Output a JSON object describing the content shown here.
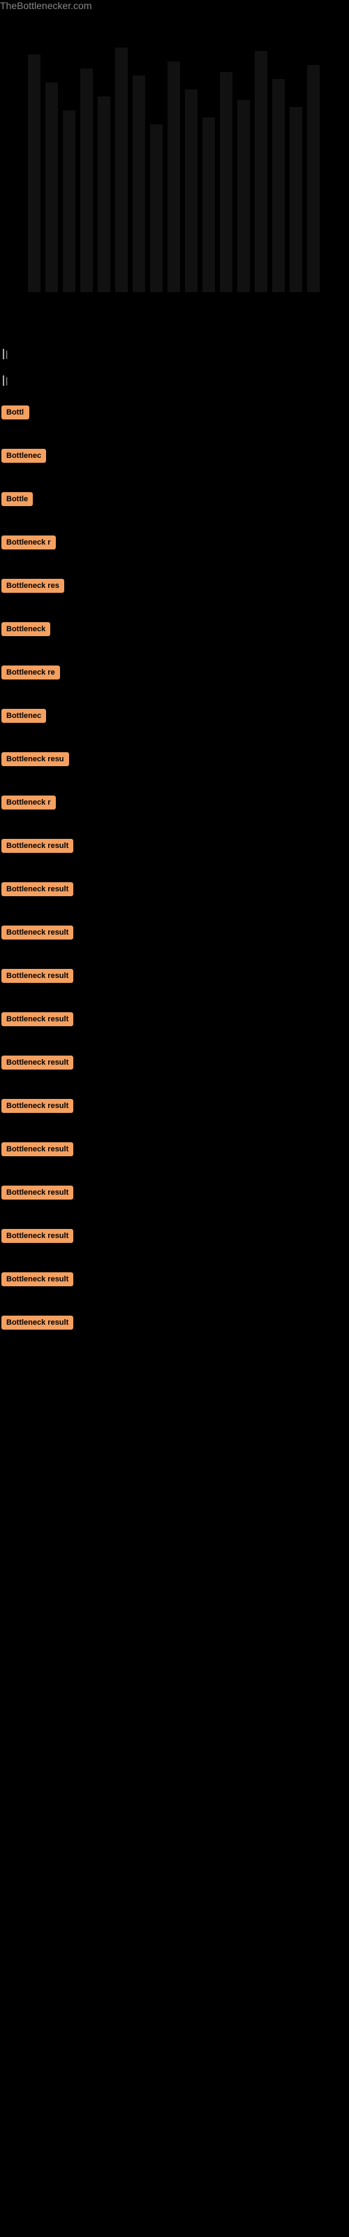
{
  "site": {
    "title": "TheBottlenecker.com"
  },
  "chart": {
    "description": "Bar chart visualization"
  },
  "text_section": {
    "cursor_line_1": "|",
    "cursor_line_2": "|"
  },
  "bottleneck_items": [
    {
      "id": 1,
      "label": "Bottl"
    },
    {
      "id": 2,
      "label": "Bottlenec"
    },
    {
      "id": 3,
      "label": "Bottle"
    },
    {
      "id": 4,
      "label": "Bottleneck r"
    },
    {
      "id": 5,
      "label": "Bottleneck res"
    },
    {
      "id": 6,
      "label": "Bottleneck"
    },
    {
      "id": 7,
      "label": "Bottleneck re"
    },
    {
      "id": 8,
      "label": "Bottlenec"
    },
    {
      "id": 9,
      "label": "Bottleneck resu"
    },
    {
      "id": 10,
      "label": "Bottleneck r"
    },
    {
      "id": 11,
      "label": "Bottleneck result"
    },
    {
      "id": 12,
      "label": "Bottleneck result"
    },
    {
      "id": 13,
      "label": "Bottleneck result"
    },
    {
      "id": 14,
      "label": "Bottleneck result"
    },
    {
      "id": 15,
      "label": "Bottleneck result"
    },
    {
      "id": 16,
      "label": "Bottleneck result"
    },
    {
      "id": 17,
      "label": "Bottleneck result"
    },
    {
      "id": 18,
      "label": "Bottleneck result"
    },
    {
      "id": 19,
      "label": "Bottleneck result"
    },
    {
      "id": 20,
      "label": "Bottleneck result"
    },
    {
      "id": 21,
      "label": "Bottleneck result"
    },
    {
      "id": 22,
      "label": "Bottleneck result"
    }
  ]
}
